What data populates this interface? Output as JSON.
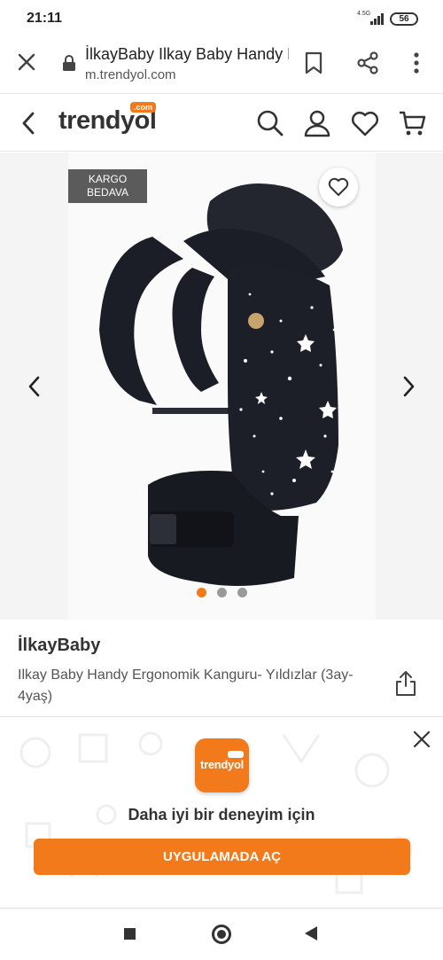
{
  "status_bar": {
    "time": "21:11",
    "network": "4.5G",
    "battery": "56"
  },
  "browser": {
    "title": "İlkayBaby Ilkay Baby Handy Ergonomik Kanguru",
    "url": "m.trendyol.com"
  },
  "header": {
    "logo": "trendyol",
    "logo_badge": ".com"
  },
  "gallery": {
    "badge": [
      "KARGO",
      "BEDAVA"
    ],
    "dot_count": 3,
    "active_dot": 0
  },
  "product": {
    "brand": "İlkayBaby",
    "name": "Ilkay Baby Handy Ergonomik Kanguru- Yıldızlar (3ay-4yaş)"
  },
  "app_banner": {
    "app_logo_text": "trendyol",
    "message": "Daha iyi bir deneyim için",
    "cta": "UYGULAMADA AÇ"
  },
  "colors": {
    "accent": "#f27a1a",
    "badge_bg": "#5b5b5b"
  }
}
